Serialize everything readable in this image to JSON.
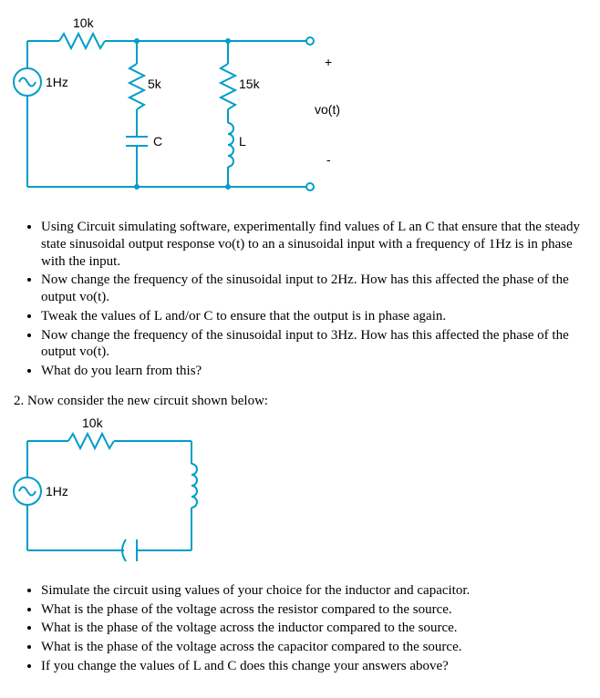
{
  "circuit1": {
    "r1": "10k",
    "src_freq": "1Hz",
    "r2": "5k",
    "r3": "15k",
    "cap": "C",
    "ind": "L",
    "out_plus": "+",
    "out_label": "vo(t)",
    "out_minus": "-"
  },
  "text1": {
    "b1": "Using Circuit simulating software, experimentally find values of L an C that ensure that the steady state sinusoidal output response vo(t) to an a sinusoidal input with a frequency of 1Hz is in phase with the input.",
    "b2": "Now change the frequency of the sinusoidal input to 2Hz.  How has this affected the phase of the output vo(t).",
    "b3": "Tweak the values of L and/or C to ensure that the output is in phase again.",
    "b4": "Now change the frequency of the sinusoidal input to 3Hz.  How has this affected the phase of the output vo(t).",
    "b5": "What do you learn from this?"
  },
  "q2": {
    "intro": "2.  Now consider the new circuit shown below:"
  },
  "circuit2": {
    "r1": "10k",
    "src_freq": "1Hz"
  },
  "text2": {
    "b1": "Simulate the circuit using values of your choice for the inductor and capacitor.",
    "b2": "What is the phase of the voltage across the resistor compared to the source.",
    "b3": "What is the phase of the voltage across the inductor compared to the source.",
    "b4": "What is the phase of the voltage across the capacitor compared to the source.",
    "b5": "If you change the values of L and C does this change your answers above?"
  }
}
